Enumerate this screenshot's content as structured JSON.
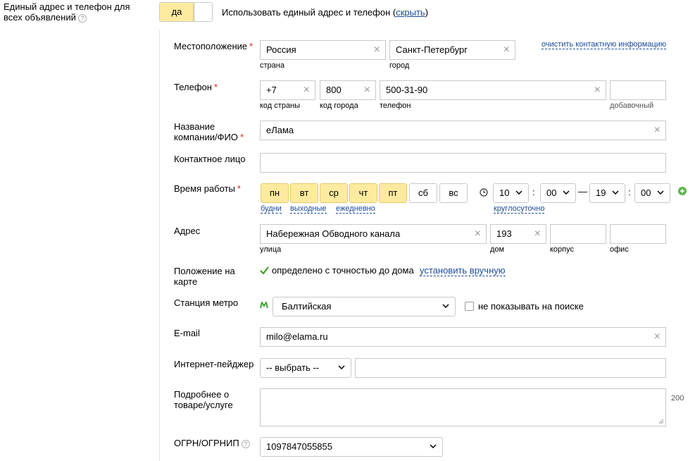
{
  "top": {
    "label_line1": "Единый адрес и телефон для",
    "label_line2": "всех объявлений",
    "help": "?",
    "toggle_on": "да",
    "toggle_text": "Использовать единый адрес и телефон (",
    "toggle_link": "скрыть",
    "toggle_text_end": ")"
  },
  "location": {
    "label": "Местоположение",
    "req": "*",
    "country_value": "Россия",
    "country_caption": "страна",
    "city_value": "Санкт-Петербург",
    "city_caption": "город",
    "clear_link": "очистить контактную информацию"
  },
  "phone": {
    "label": "Телефон",
    "req": "*",
    "country_code": "+7",
    "country_code_caption": "код страны",
    "city_code": "800",
    "city_code_caption": "код города",
    "number": "500-31-90",
    "number_caption": "телефон",
    "ext": "",
    "ext_caption": "добавочный"
  },
  "company": {
    "label_line1": "Название",
    "label_line2": "компании/ФИО",
    "req": "*",
    "value": "еЛама"
  },
  "contact": {
    "label": "Контактное лицо",
    "value": ""
  },
  "hours": {
    "label": "Время работы",
    "req": "*",
    "days": [
      {
        "label": "пн",
        "active": true
      },
      {
        "label": "вт",
        "active": true
      },
      {
        "label": "ср",
        "active": true
      },
      {
        "label": "чт",
        "active": true
      },
      {
        "label": "пт",
        "active": true
      },
      {
        "label": "сб",
        "active": false
      },
      {
        "label": "вс",
        "active": false
      }
    ],
    "link_weekdays": "будни",
    "link_weekends": "выходные",
    "link_daily": "ежедневно",
    "from_hour": "10",
    "from_min": "00",
    "to_hour": "19",
    "to_min": "00",
    "colon": ":",
    "dash": "—",
    "link_24h": "круглосуточно",
    "clock_icon": "clock-icon",
    "add_icon": "plus-circle-icon"
  },
  "address": {
    "label": "Адрес",
    "street": "Набережная Обводного канала",
    "street_caption": "улица",
    "house": "193",
    "house_caption": "дом",
    "building": "",
    "building_caption": "корпус",
    "office": "",
    "office_caption": "офис"
  },
  "map": {
    "label_line1": "Положение на",
    "label_line2": "карте",
    "status": "определено с точностью до дома",
    "link": "установить вручную"
  },
  "metro": {
    "label": "Станция метро",
    "value": "Балтийская",
    "hide_label": "не показывать на поиске"
  },
  "email": {
    "label": "E-mail",
    "value": "milo@elama.ru"
  },
  "pager": {
    "label": "Интернет-пейджер",
    "select": "-- выбрать --",
    "value": ""
  },
  "details": {
    "label_line1": "Подробнее о",
    "label_line2": "товаре/услуге",
    "value": "",
    "counter": "200"
  },
  "ogrn": {
    "label": "ОГРН/ОГРНИП",
    "help": "?",
    "value": "1097847055855"
  },
  "colors": {
    "accent_yellow": "#ffeba0",
    "link_blue": "#1a4a9a",
    "required_red": "#e52020",
    "check_green": "#3a9a1a",
    "metro_green": "#3aa635"
  }
}
